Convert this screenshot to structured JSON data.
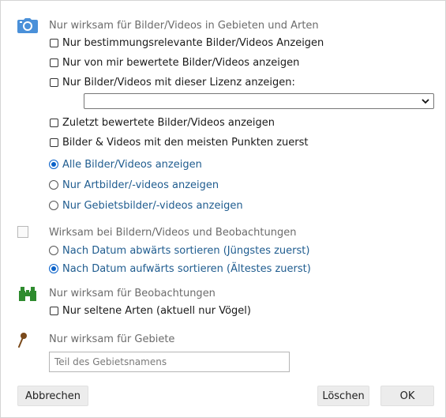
{
  "section_media": {
    "title": "Nur wirksam für Bilder/Videos in Gebieten und Arten",
    "icon": "camera-icon",
    "checkbox_1": "Nur bestimmungsrelevante Bilder/Videos Anzeigen",
    "checkbox_2": "Nur von mir bewertete Bilder/Videos anzeigen",
    "checkbox_3": "Nur Bilder/Videos mit dieser Lizenz anzeigen:",
    "license_select_value": "",
    "checkbox_4": "Zuletzt bewertete Bilder/Videos anzeigen",
    "checkbox_5": "Bilder & Videos mit den meisten Punkten zuerst",
    "radio_1": "Alle Bilder/Videos anzeigen",
    "radio_2": "Nur Artbilder/-videos anzeigen",
    "radio_3": "Nur Gebietsbilder/-videos anzeigen",
    "selected_radio": "radio_1"
  },
  "section_sort": {
    "title": "Wirksam bei Bildern/Videos und Beobachtungen",
    "icon": "broken-image-icon",
    "radio_1": "Nach Datum abwärts sortieren (Jüngstes zuerst)",
    "radio_2": "Nach Datum aufwärts sortieren (Ältestes zuerst)",
    "selected_radio": "radio_2"
  },
  "section_observations": {
    "title": "Nur wirksam für Beobachtungen",
    "icon": "binoculars-icon",
    "checkbox_1": "Nur seltene Arten (aktuell nur Vögel)"
  },
  "section_areas": {
    "title": "Nur wirksam für Gebiete",
    "icon": "map-pin-icon",
    "area_name_placeholder": "Teil des Gebietsnamens",
    "area_name_value": ""
  },
  "buttons": {
    "cancel": "Abbrechen",
    "delete": "Löschen",
    "ok": "OK"
  },
  "colors": {
    "icon_blue": "#4a90d9",
    "binoculars_green": "#2e8b2e",
    "pin_brown": "#7a4a1c",
    "radio_text": "#1f5c8f",
    "radio_checked": "#0b62c9"
  }
}
